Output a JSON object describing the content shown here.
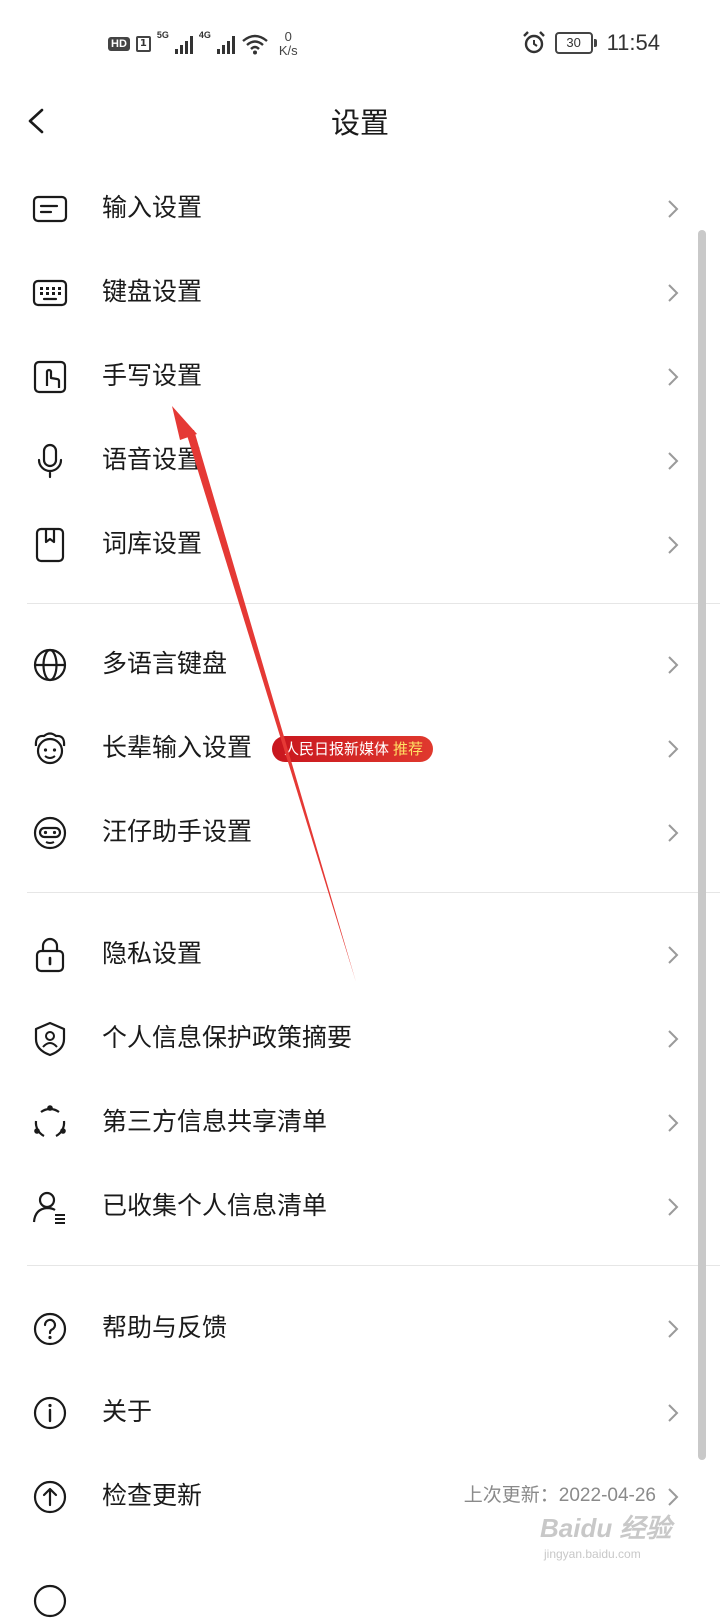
{
  "status_bar": {
    "hd_label": "HD",
    "sim_label": "1",
    "signal_5g": "5G",
    "signal_4g": "4G",
    "net_speed_value": "0",
    "net_speed_unit": "K/s",
    "battery_level": "30",
    "time": "11:54"
  },
  "header": {
    "title": "设置",
    "back_icon": "chevron-left-icon"
  },
  "sections": [
    {
      "items": [
        {
          "label": "输入设置",
          "icon": "input-settings-icon"
        },
        {
          "label": "键盘设置",
          "icon": "keyboard-icon"
        },
        {
          "label": "手写设置",
          "icon": "handwriting-icon"
        },
        {
          "label": "语音设置",
          "icon": "microphone-icon"
        },
        {
          "label": "词库设置",
          "icon": "dictionary-icon"
        }
      ]
    },
    {
      "items": [
        {
          "label": "多语言键盘",
          "icon": "globe-icon"
        },
        {
          "label": "长辈输入设置",
          "icon": "elder-face-icon",
          "badge": {
            "text": "人民日报新媒体",
            "highlight": "推荐"
          }
        },
        {
          "label": "汪仔助手设置",
          "icon": "assistant-icon"
        }
      ]
    },
    {
      "items": [
        {
          "label": "隐私设置",
          "icon": "lock-icon"
        },
        {
          "label": "个人信息保护政策摘要",
          "icon": "shield-icon"
        },
        {
          "label": "第三方信息共享清单",
          "icon": "share-circle-icon"
        },
        {
          "label": "已收集个人信息清单",
          "icon": "person-list-icon"
        }
      ]
    },
    {
      "items": [
        {
          "label": "帮助与反馈",
          "icon": "help-icon"
        },
        {
          "label": "关于",
          "icon": "info-icon"
        },
        {
          "label": "检查更新",
          "icon": "upload-icon",
          "extra": "上次更新：2022-04-26"
        }
      ]
    }
  ],
  "watermark": {
    "line1": "Baidu 经验",
    "line2": "jingyan.baidu.com"
  },
  "colors": {
    "badge_red": "#d42a25",
    "arrow_red": "#e53935"
  }
}
